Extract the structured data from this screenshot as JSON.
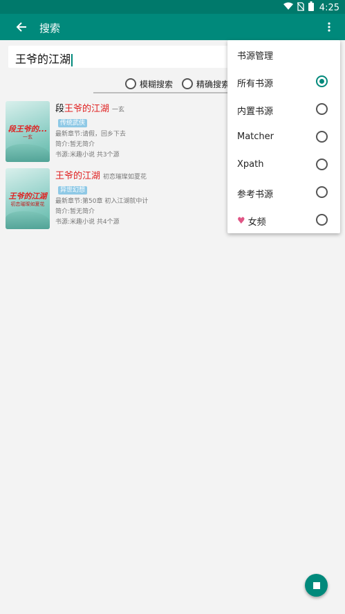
{
  "status": {
    "time": "4:25"
  },
  "toolbar": {
    "title": "搜索"
  },
  "search": {
    "query": "王爷的江湖"
  },
  "modes": [
    {
      "label": "模糊搜索",
      "selected": false
    },
    {
      "label": "精确搜索",
      "selected": false
    }
  ],
  "results": [
    {
      "name_prefix": "段",
      "name_highlight": "王爷的江湖",
      "author": "一玄",
      "tag": "传统武侠",
      "latest": "最新章节:请假，回乡下去",
      "intro": "简介:暂无简介",
      "source": "书源:米趣小说 共3个源",
      "cover_title": "段王爷的...",
      "cover_sub": "一玄"
    },
    {
      "name_prefix": "",
      "name_highlight": "王爷的江湖",
      "author": "初恋璀璨如夏花",
      "tag": "异世幻想",
      "latest": "最新章节:第50章 初入江湖就中计",
      "intro": "简介:暂无简介",
      "source": "书源:米趣小说 共4个源",
      "cover_title": "王爷的江湖",
      "cover_sub": "初恋璀璨如夏花"
    }
  ],
  "menu": {
    "header": "书源管理",
    "items": [
      {
        "label": "所有书源",
        "checked": true
      },
      {
        "label": "内置书源",
        "checked": false
      },
      {
        "label": "Matcher",
        "checked": false
      },
      {
        "label": "Xpath",
        "checked": false
      },
      {
        "label": "参考书源",
        "checked": false
      },
      {
        "label": "女频",
        "checked": false,
        "icon": "heart-icon"
      }
    ]
  },
  "colors": {
    "primary": "#00897b",
    "status_bar": "#00796b",
    "highlight": "#e02020"
  }
}
